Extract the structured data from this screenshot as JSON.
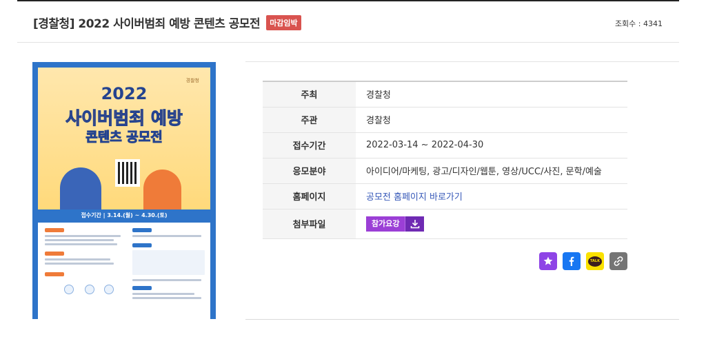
{
  "header": {
    "title": "[경찰청] 2022 사이버범죄 예방 콘텐츠 공모전",
    "badge": "마감임박",
    "views": "조회수 : 4341"
  },
  "poster": {
    "logo": "경찰청",
    "year": "2022",
    "title": "사이버범죄 예방",
    "subtitle": "콘텐츠 공모전",
    "period": "접수기간 | 3.14.(월) ~ 4.30.(토)"
  },
  "info": {
    "rows": [
      {
        "label": "주최",
        "value": "경찰청"
      },
      {
        "label": "주관",
        "value": "경찰청"
      },
      {
        "label": "접수기간",
        "value": "2022-03-14 ~ 2022-04-30"
      },
      {
        "label": "응모분야",
        "value": "아이디어/마케팅, 광고/디자인/웹툰, 영상/UCC/사진, 문학/예술"
      }
    ],
    "homepage": {
      "label": "홈페이지",
      "link_text": "공모전 홈페이지 바로가기"
    },
    "attachment": {
      "label": "첨부파일",
      "button_label": "참가요강"
    }
  },
  "share": {
    "kakaotalk_label": "TALK",
    "colors": {
      "star": "#8e44e6",
      "facebook": "#1877f2",
      "kakaotalk": "#fae100",
      "link": "#757575"
    }
  }
}
